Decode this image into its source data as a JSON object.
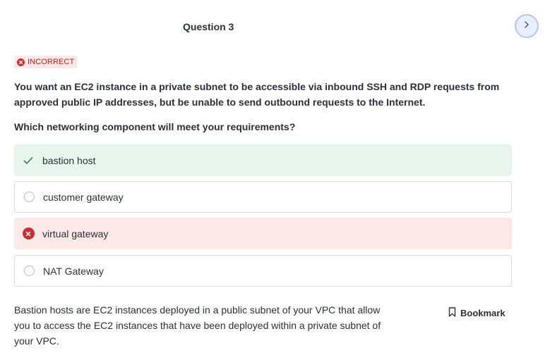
{
  "header": {
    "question_title": "Question 3",
    "next_icon": "chevron-right-icon"
  },
  "status": {
    "label": "INCORRECT",
    "icon": "x-circle-icon",
    "color": "#c53030"
  },
  "question": {
    "text": "You want an EC2 instance in a private subnet to be accessible via inbound SSH and RDP requests from approved public IP addresses, but be unable to send outbound requests to the Internet.",
    "prompt": "Which networking component will meet your requirements?"
  },
  "options": [
    {
      "label": "bastion host",
      "state": "correct",
      "icon": "check-icon"
    },
    {
      "label": "customer gateway",
      "state": "unselected",
      "icon": "radio-icon"
    },
    {
      "label": "virtual gateway",
      "state": "incorrect-selected",
      "icon": "x-circle-icon"
    },
    {
      "label": "NAT Gateway",
      "state": "unselected",
      "icon": "radio-icon"
    }
  ],
  "explanation": {
    "text": "Bastion hosts are EC2 instances deployed in a public subnet of your VPC that allow you to access the EC2 instances that have been deployed within a private subnet of your VPC."
  },
  "bookmark": {
    "label": "Bookmark",
    "icon": "bookmark-icon"
  },
  "colors": {
    "correct_bg": "#e8f5ec",
    "incorrect_bg": "#fde8e8",
    "check_green": "#2e7d4f",
    "accent_blue": "#b6c5f2"
  }
}
